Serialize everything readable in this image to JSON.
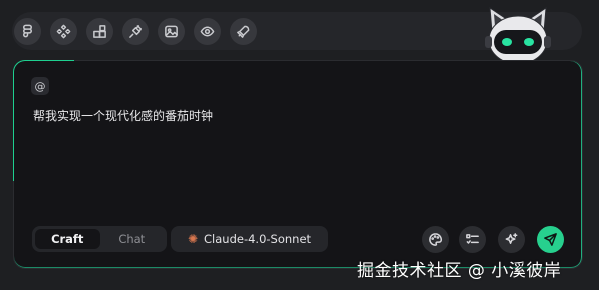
{
  "toolbar": {
    "tools": [
      {
        "icon": "figma-icon"
      },
      {
        "icon": "components-icon"
      },
      {
        "icon": "layout-blocks-icon"
      },
      {
        "icon": "plug-icon"
      },
      {
        "icon": "image-icon"
      },
      {
        "icon": "eye-icon"
      },
      {
        "icon": "rocket-icon"
      }
    ]
  },
  "composer": {
    "mention_label": "@",
    "prompt_text": "帮我实现一个现代化感的番茄时钟",
    "modes": [
      "Craft",
      "Chat"
    ],
    "active_mode": "Craft",
    "model_label": "Claude-4.0-Sonnet",
    "model_icon": "sparkle-icon"
  },
  "actions": [
    {
      "icon": "palette-icon"
    },
    {
      "icon": "checklist-icon"
    },
    {
      "icon": "magic-sparkle-icon"
    },
    {
      "icon": "send-icon"
    }
  ],
  "colors": {
    "accent": "#27d08e",
    "background": "#1e1f22",
    "card": "#141417"
  },
  "watermark": "掘金技术社区 @ 小溪彼岸"
}
